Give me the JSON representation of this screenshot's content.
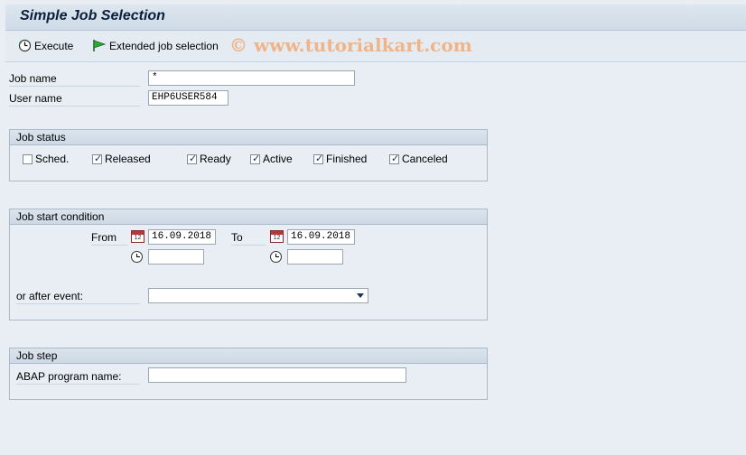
{
  "window": {
    "title": "Simple Job Selection"
  },
  "toolbar": {
    "execute_label": "Execute",
    "extended_label": "Extended job selection",
    "watermark": "© www.tutorialkart.com"
  },
  "fields": {
    "job_name_label": "Job name",
    "job_name_value": "*",
    "user_name_label": "User name",
    "user_name_value": "EHP6USER584"
  },
  "job_status": {
    "title": "Job status",
    "options": [
      {
        "label": "Sched.",
        "checked": false
      },
      {
        "label": "Released",
        "checked": true
      },
      {
        "label": "Ready",
        "checked": true
      },
      {
        "label": "Active",
        "checked": true
      },
      {
        "label": "Finished",
        "checked": true
      },
      {
        "label": "Canceled",
        "checked": true
      }
    ]
  },
  "start_condition": {
    "title": "Job start condition",
    "from_label": "From",
    "from_date": "16.09.2018",
    "from_time": "",
    "to_label": "To",
    "to_date": "16.09.2018",
    "to_time": "",
    "after_event_label": "or after event:",
    "after_event_value": ""
  },
  "job_step": {
    "title": "Job step",
    "program_label": "ABAP program name:",
    "program_value": ""
  },
  "icons": {
    "execute": "clock-execute-icon",
    "extended": "green-flag-icon",
    "calendar": "calendar-icon",
    "clock": "clock-icon",
    "dropdown": "chevron-down-icon"
  }
}
